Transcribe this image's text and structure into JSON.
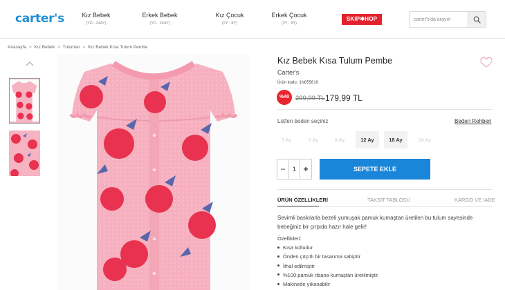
{
  "header": {
    "logo": "carter's",
    "nav": [
      {
        "label": "Kız Bebek",
        "sub": "(YD - 24AY)"
      },
      {
        "label": "Erkek Bebek",
        "sub": "(YD - 24AY)"
      },
      {
        "label": "Kız Çocuk",
        "sub": "(2Y - 8Y)"
      },
      {
        "label": "Erkek Çocuk",
        "sub": "(2Y - 8Y)"
      }
    ],
    "skiphop": "SKIP✱HOP",
    "search_placeholder": "carter's'da arayın"
  },
  "breadcrumb": [
    "Anasayfa",
    "Kız Bebek",
    "Tulumlar",
    "Kız Bebek Kısa Tulum Pembe"
  ],
  "breadcrumb_sep": ">",
  "product": {
    "title": "Kız Bebek Kısa Tulum Pembe",
    "brand": "Carter's",
    "sku_label": "Ürün kodu:",
    "sku": "1N055610",
    "discount": "%40",
    "old_price": "299,99 TL",
    "new_price": "179,99 TL"
  },
  "sizes": {
    "label": "Lütfen beden seçiniz",
    "guide": "Beden Rehberi",
    "options": [
      {
        "label": "3 Ay",
        "available": false
      },
      {
        "label": "6 Ay",
        "available": false
      },
      {
        "label": "9 Ay",
        "available": false
      },
      {
        "label": "12 Ay",
        "available": true
      },
      {
        "label": "18 Ay",
        "available": true
      },
      {
        "label": "24 Ay",
        "available": false
      }
    ]
  },
  "quantity": {
    "minus": "−",
    "value": "1",
    "plus": "+"
  },
  "add_to_cart": "SEPETE EKLE",
  "tabs": [
    "ÜRÜN ÖZELLİKLERİ",
    "TAKSİT TABLOSU",
    "KARGO VE İADE"
  ],
  "description": "Sevimli baskılarla bezeli yumuşak pamuk kumaştan üretilen bu tulum sayesinde bebeğiniz bir çırpıda hazır hale gelir!",
  "features_title": "Özellikleri:",
  "features": [
    "Kısa kolludur",
    "Önden çıtçıtlı bir tasarıma sahiptir",
    "İthal edilmiştir",
    "%100 pamuk ribana kumaştan üretilmiştir",
    "Makinede yıkanabilir"
  ],
  "colors": {
    "brand_blue": "#1f8fd6",
    "cta_blue": "#1a86d9",
    "sale_red": "#e8262f",
    "garment_pink": "#f4a9b8"
  }
}
